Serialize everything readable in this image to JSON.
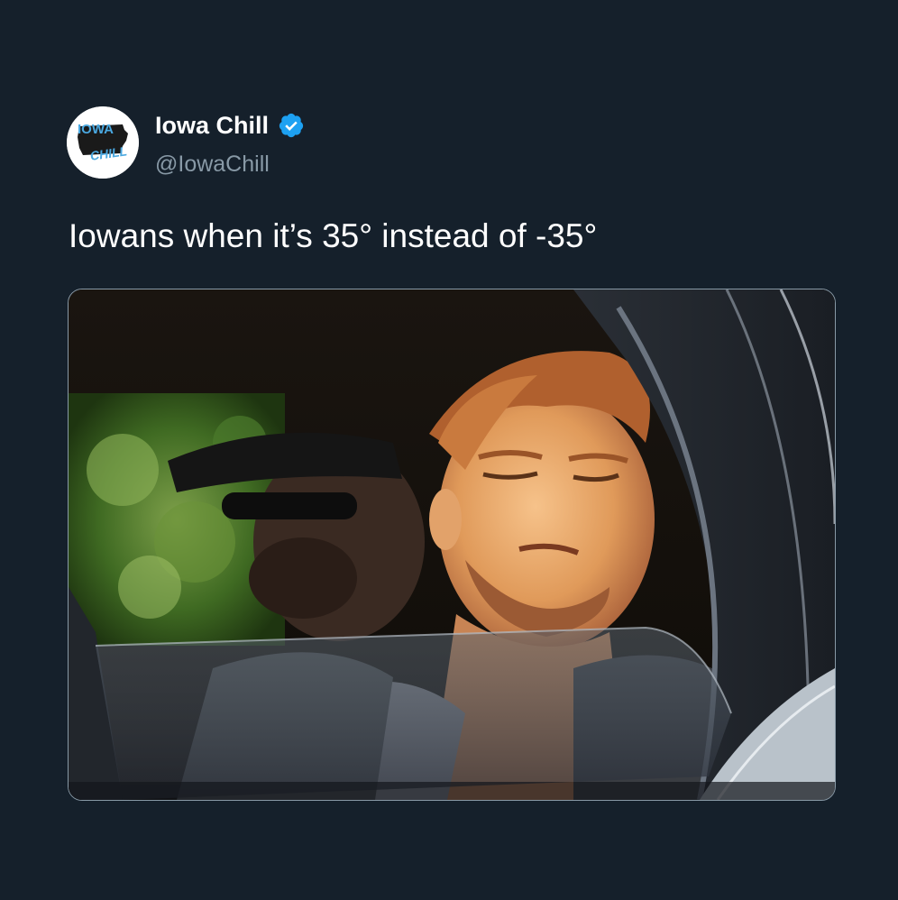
{
  "tweet": {
    "author": {
      "display_name": "Iowa Chill",
      "handle": "@IowaChill",
      "verified": true,
      "avatar_text_top": "IOWA",
      "avatar_text_bottom": "CHILL",
      "avatar_icon": "iowa-chill-logo"
    },
    "text": "Iowans when it’s 35° instead of -35°",
    "media": {
      "type": "photo",
      "icon": "photo-man-in-car-window"
    }
  },
  "colors": {
    "background": "#15202b",
    "name_text": "#ffffff",
    "handle_text": "#8899a6",
    "verified_badge": "#1da1f2",
    "media_border": "#8899a6"
  }
}
